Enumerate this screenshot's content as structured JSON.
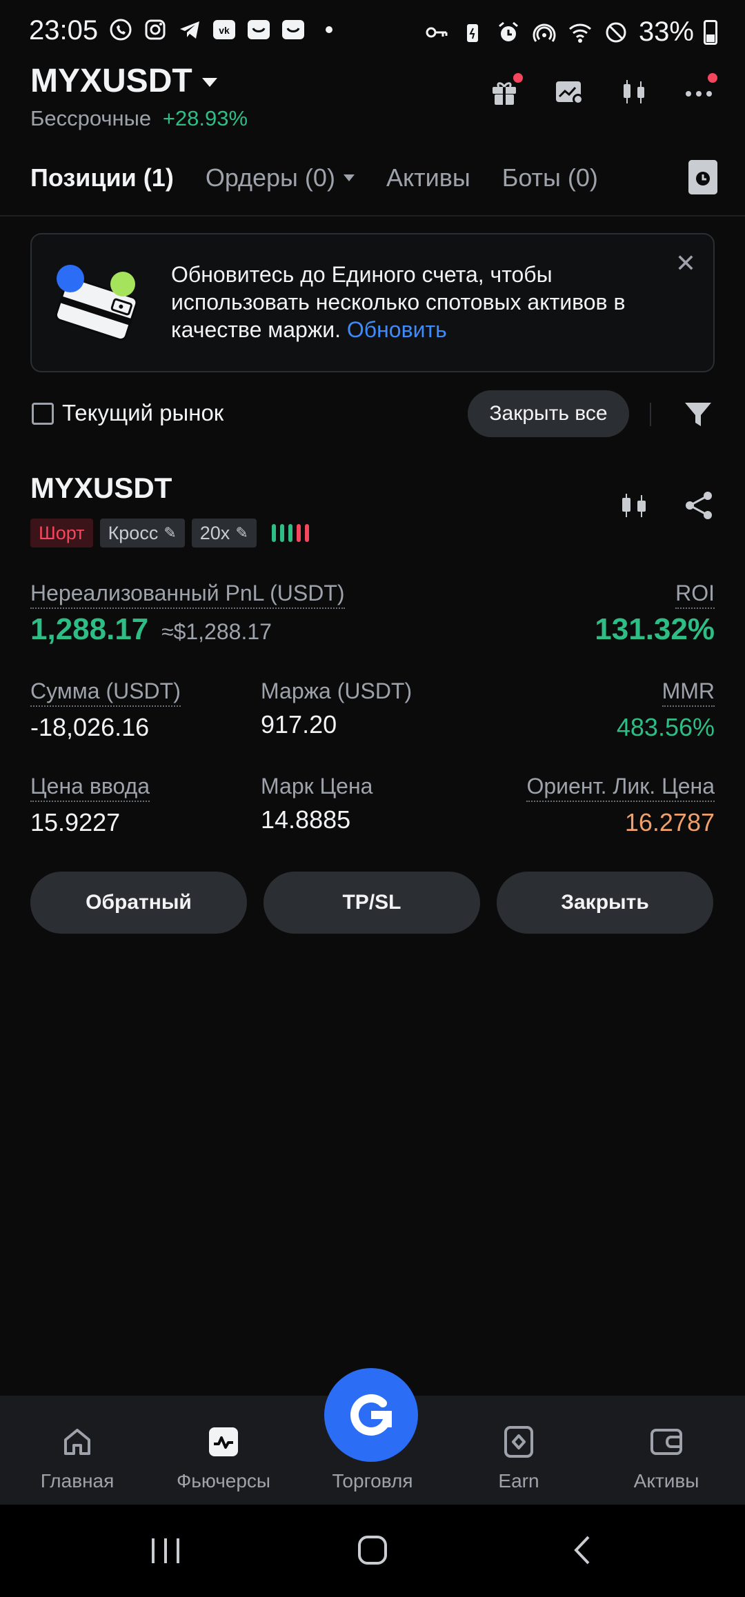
{
  "status_bar": {
    "time": "23:05",
    "battery_percent": "33%",
    "left_icons": [
      "whatsapp-icon",
      "instagram-icon",
      "telegram-icon",
      "vk-icon",
      "notification-icon",
      "notification-icon"
    ],
    "right_icons": [
      "key-icon",
      "battery-saver-icon",
      "alarm-icon",
      "hotspot-icon",
      "wifi-icon",
      "do-not-disturb-icon"
    ]
  },
  "header": {
    "pair": "MYXUSDT",
    "type": "Бессрочные",
    "change": "+28.93%"
  },
  "tabs": [
    {
      "label": "Позиции (1)",
      "active": true
    },
    {
      "label": "Ордеры (0)",
      "active": false
    },
    {
      "label": "Активы",
      "active": false
    },
    {
      "label": "Боты (0)",
      "active": false
    }
  ],
  "banner": {
    "text": "Обновитесь до Единого счета, чтобы использовать несколько спотовых активов в качестве маржи.",
    "link": "Обновить"
  },
  "filter": {
    "checkbox_label": "Текущий рынок",
    "checkbox_checked": false,
    "close_all": "Закрыть все"
  },
  "position": {
    "symbol": "MYXUSDT",
    "side": "Шорт",
    "margin_mode": "Кросс",
    "leverage": "20x",
    "risk_bar_colors": [
      "#2ebd85",
      "#2ebd85",
      "#2ebd85",
      "#f6465d",
      "#f6465d"
    ],
    "pnl_label": "Нереализованный PnL (USDT)",
    "pnl_value": "1,288.17",
    "pnl_approx": "≈$1,288.17",
    "roi_label": "ROI",
    "roi_value": "131.32%",
    "amount_label": "Сумма (USDT)",
    "amount_value": "-18,026.16",
    "margin_label": "Маржа (USDT)",
    "margin_value": "917.20",
    "mmr_label": "MMR",
    "mmr_value": "483.56%",
    "entry_label": "Цена ввода",
    "entry_value": "15.9227",
    "mark_label": "Марк Цена",
    "mark_value": "14.8885",
    "liq_label": "Ориент. Лик. Цена",
    "liq_value": "16.2787"
  },
  "actions": {
    "reverse": "Обратный",
    "tpsl": "TP/SL",
    "close": "Закрыть"
  },
  "bottom_nav": {
    "home": "Главная",
    "futures": "Фьючерсы",
    "trade": "Торговля",
    "earn": "Earn",
    "assets": "Активы"
  }
}
